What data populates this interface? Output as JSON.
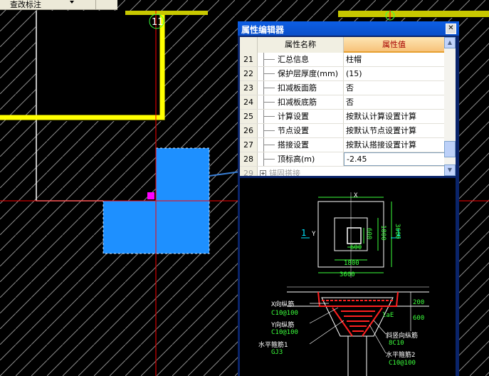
{
  "toolbar": {
    "dropdown_label": "查改标注"
  },
  "canvas": {
    "axis_label": "11"
  },
  "editor": {
    "title": "属性编辑器",
    "close_glyph": "✕",
    "header": {
      "name": "属性名称",
      "value": "属性值"
    },
    "rows": [
      {
        "num": "21",
        "name": "汇总信息",
        "value": "柱帽"
      },
      {
        "num": "22",
        "name": "保护层厚度(mm)",
        "value": "(15)"
      },
      {
        "num": "23",
        "name": "扣减板面筋",
        "value": "否"
      },
      {
        "num": "24",
        "name": "扣减板底筋",
        "value": "否"
      },
      {
        "num": "25",
        "name": "计算设置",
        "value": "按默认计算设置计算"
      },
      {
        "num": "26",
        "name": "节点设置",
        "value": "按默认节点设置计算"
      },
      {
        "num": "27",
        "name": "搭接设置",
        "value": "按默认搭接设置计算"
      },
      {
        "num": "28",
        "name": "顶标高(m)",
        "value": "-2.45"
      }
    ],
    "group_row": {
      "num": "29",
      "name": "锚固搭接"
    },
    "scroll_up": "▲",
    "scroll_down": "▼"
  },
  "diagram": {
    "dim_x": "X",
    "dim_y": "Y",
    "section_left": "1",
    "section_right": "1",
    "inner_h": "600",
    "inner_w": "600",
    "dim_1800_v": "1800",
    "dim_3600_v": "3600",
    "dim_1800_h": "1800",
    "dim_3600_h": "3600",
    "dim_200": "200",
    "dim_600": "600",
    "lae": "laE",
    "x_rebar_label": "X向纵筋",
    "x_rebar_value": "C10@100",
    "y_rebar_label": "Y向纵筋",
    "y_rebar_value": "C10@100",
    "h_stirrup1_label": "水平箍筋1",
    "h_stirrup1_value": "GJ3",
    "slant_label": "斜竖向纵筋",
    "slant_value": "8C10",
    "h_stirrup2_label": "水平箍筋2",
    "h_stirrup2_value": "C10@100"
  },
  "colors": {
    "column_fill": "#1e90ff",
    "beam_yellow": "#ffff00",
    "grid_red": "#ff0000",
    "hatch": "#8c8c8c",
    "rebar_red": "#ff2020",
    "dim_green": "#3cff3c",
    "section_cyan": "#00e5ff"
  }
}
